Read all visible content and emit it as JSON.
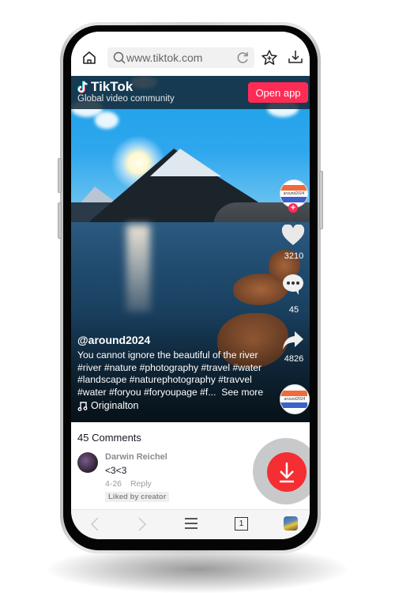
{
  "browser": {
    "url": "www.tiktok.com",
    "icons": [
      "home-icon",
      "search-icon",
      "reload-icon",
      "bookmark-star-icon",
      "download-icon"
    ]
  },
  "tiktok_header": {
    "brand": "TikTok",
    "tagline": "Global video community",
    "open_app_label": "Open app",
    "accent": "#fe2c55"
  },
  "video": {
    "creator_avatar_text": "around2024",
    "likes": "3210",
    "comments": "45",
    "shares": "4826",
    "username": "@around2024",
    "caption": "You cannot ignore the beautiful of the river #river #nature #photography #travel #water #landscape #naturephotography #travvel #water #foryou #foryoupage #f...",
    "see_more": "See more",
    "music": "Originalton"
  },
  "comments": {
    "title": "45 Comments",
    "items": [
      {
        "author": "Darwin Reichel",
        "text": "<3<3",
        "date": "4-26",
        "reply_label": "Reply",
        "badge": "Liked by creator"
      }
    ]
  },
  "download_fab": {
    "color": "#f42e33"
  },
  "navbar": {
    "tab_count": "1",
    "icons": [
      "back-icon",
      "forward-icon",
      "menu-icon",
      "tabs-icon",
      "profile-icon"
    ]
  }
}
